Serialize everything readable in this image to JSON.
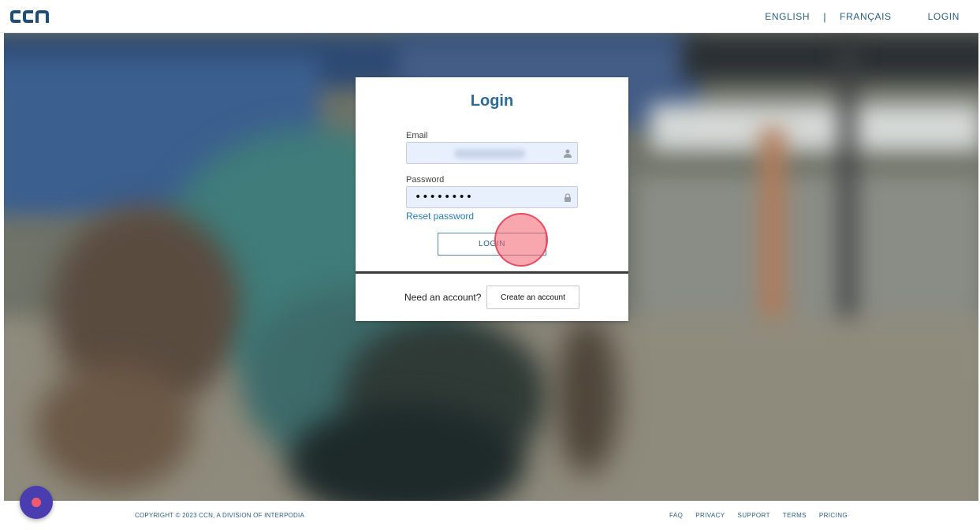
{
  "header": {
    "logo_text": "ccn",
    "nav": {
      "english": "ENGLISH",
      "separator": "|",
      "french": "FRANÇAIS",
      "login": "LOGIN"
    }
  },
  "login_card": {
    "title": "Login",
    "email": {
      "label": "Email",
      "value": "",
      "icon": "user-icon"
    },
    "password": {
      "label": "Password",
      "value": "••••••••",
      "icon": "lock-icon"
    },
    "reset_password": "Reset password",
    "login_button": "LOGIN",
    "need_account": "Need an account?",
    "create_account_button": "Create an account"
  },
  "footer": {
    "copyright": "COPYRIGHT © 2023 CCN, A DIVISION OF INTERPODIA",
    "links": [
      "FAQ",
      "PRIVACY",
      "SUPPORT",
      "TERMS",
      "PRICING"
    ]
  },
  "colors": {
    "brand": "#2b5f86",
    "link": "#2b7bb9",
    "click_marker": "#f25f6e",
    "chat_button": "#4a3db0"
  }
}
